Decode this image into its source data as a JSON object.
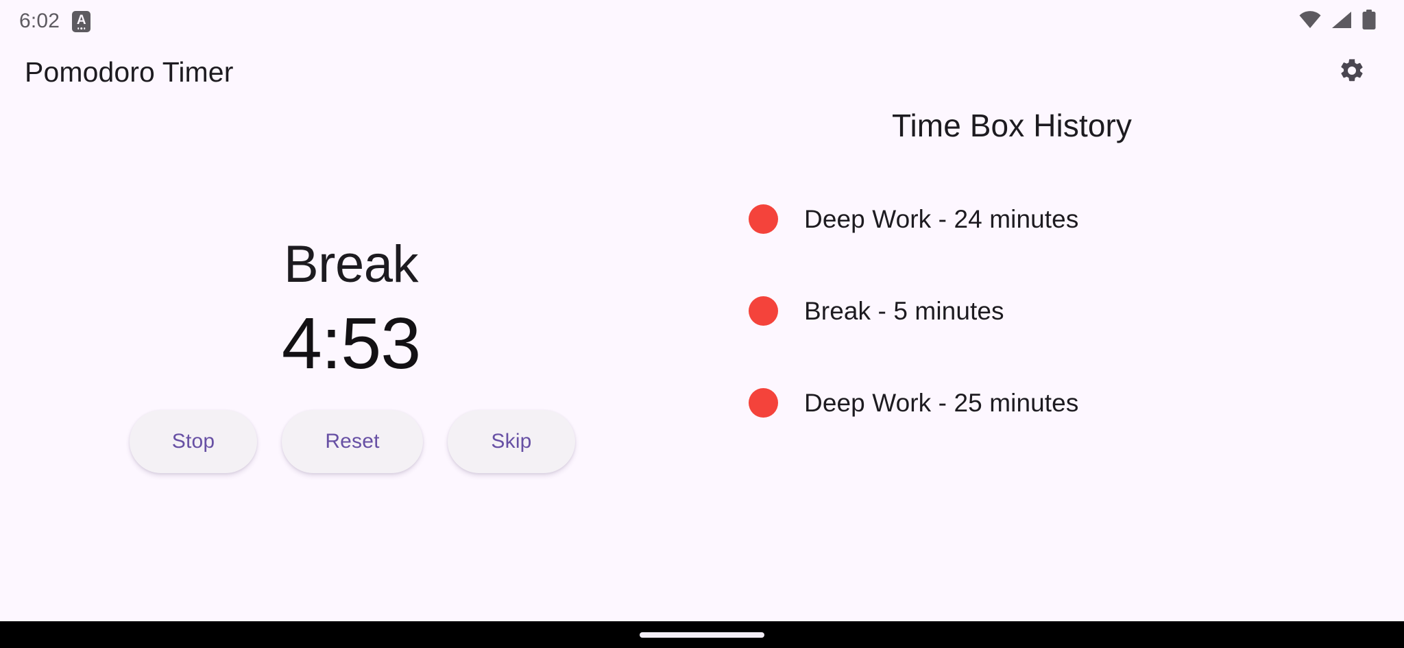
{
  "status_bar": {
    "clock": "6:02",
    "app_badge_glyph": "A",
    "icons": [
      "wifi-icon",
      "cellular-signal-icon",
      "battery-icon"
    ],
    "icon_color": "#5D5A60"
  },
  "app_bar": {
    "title": "Pomodoro Timer",
    "settings_icon": "gear-icon",
    "settings_icon_color": "#4A4650"
  },
  "timer": {
    "session_label": "Break",
    "time_remaining": "4:53",
    "buttons": [
      {
        "label": "Stop"
      },
      {
        "label": "Reset"
      },
      {
        "label": "Skip"
      }
    ],
    "button_text_color": "#6750A4",
    "button_bg_color": "#F4F1F5"
  },
  "history": {
    "title": "Time Box History",
    "dot_color": "#F4433B",
    "items": [
      {
        "label": "Deep Work - 24 minutes"
      },
      {
        "label": "Break - 5 minutes"
      },
      {
        "label": "Deep Work - 25 minutes"
      }
    ]
  },
  "nav_bar": {
    "gesture_pill": "home-gesture-pill",
    "background_color": "#000000"
  },
  "theme": {
    "background": "#FDF7FF",
    "on_background": "#1D1B20",
    "primary": "#6750A4",
    "accent_red": "#F4433B"
  }
}
